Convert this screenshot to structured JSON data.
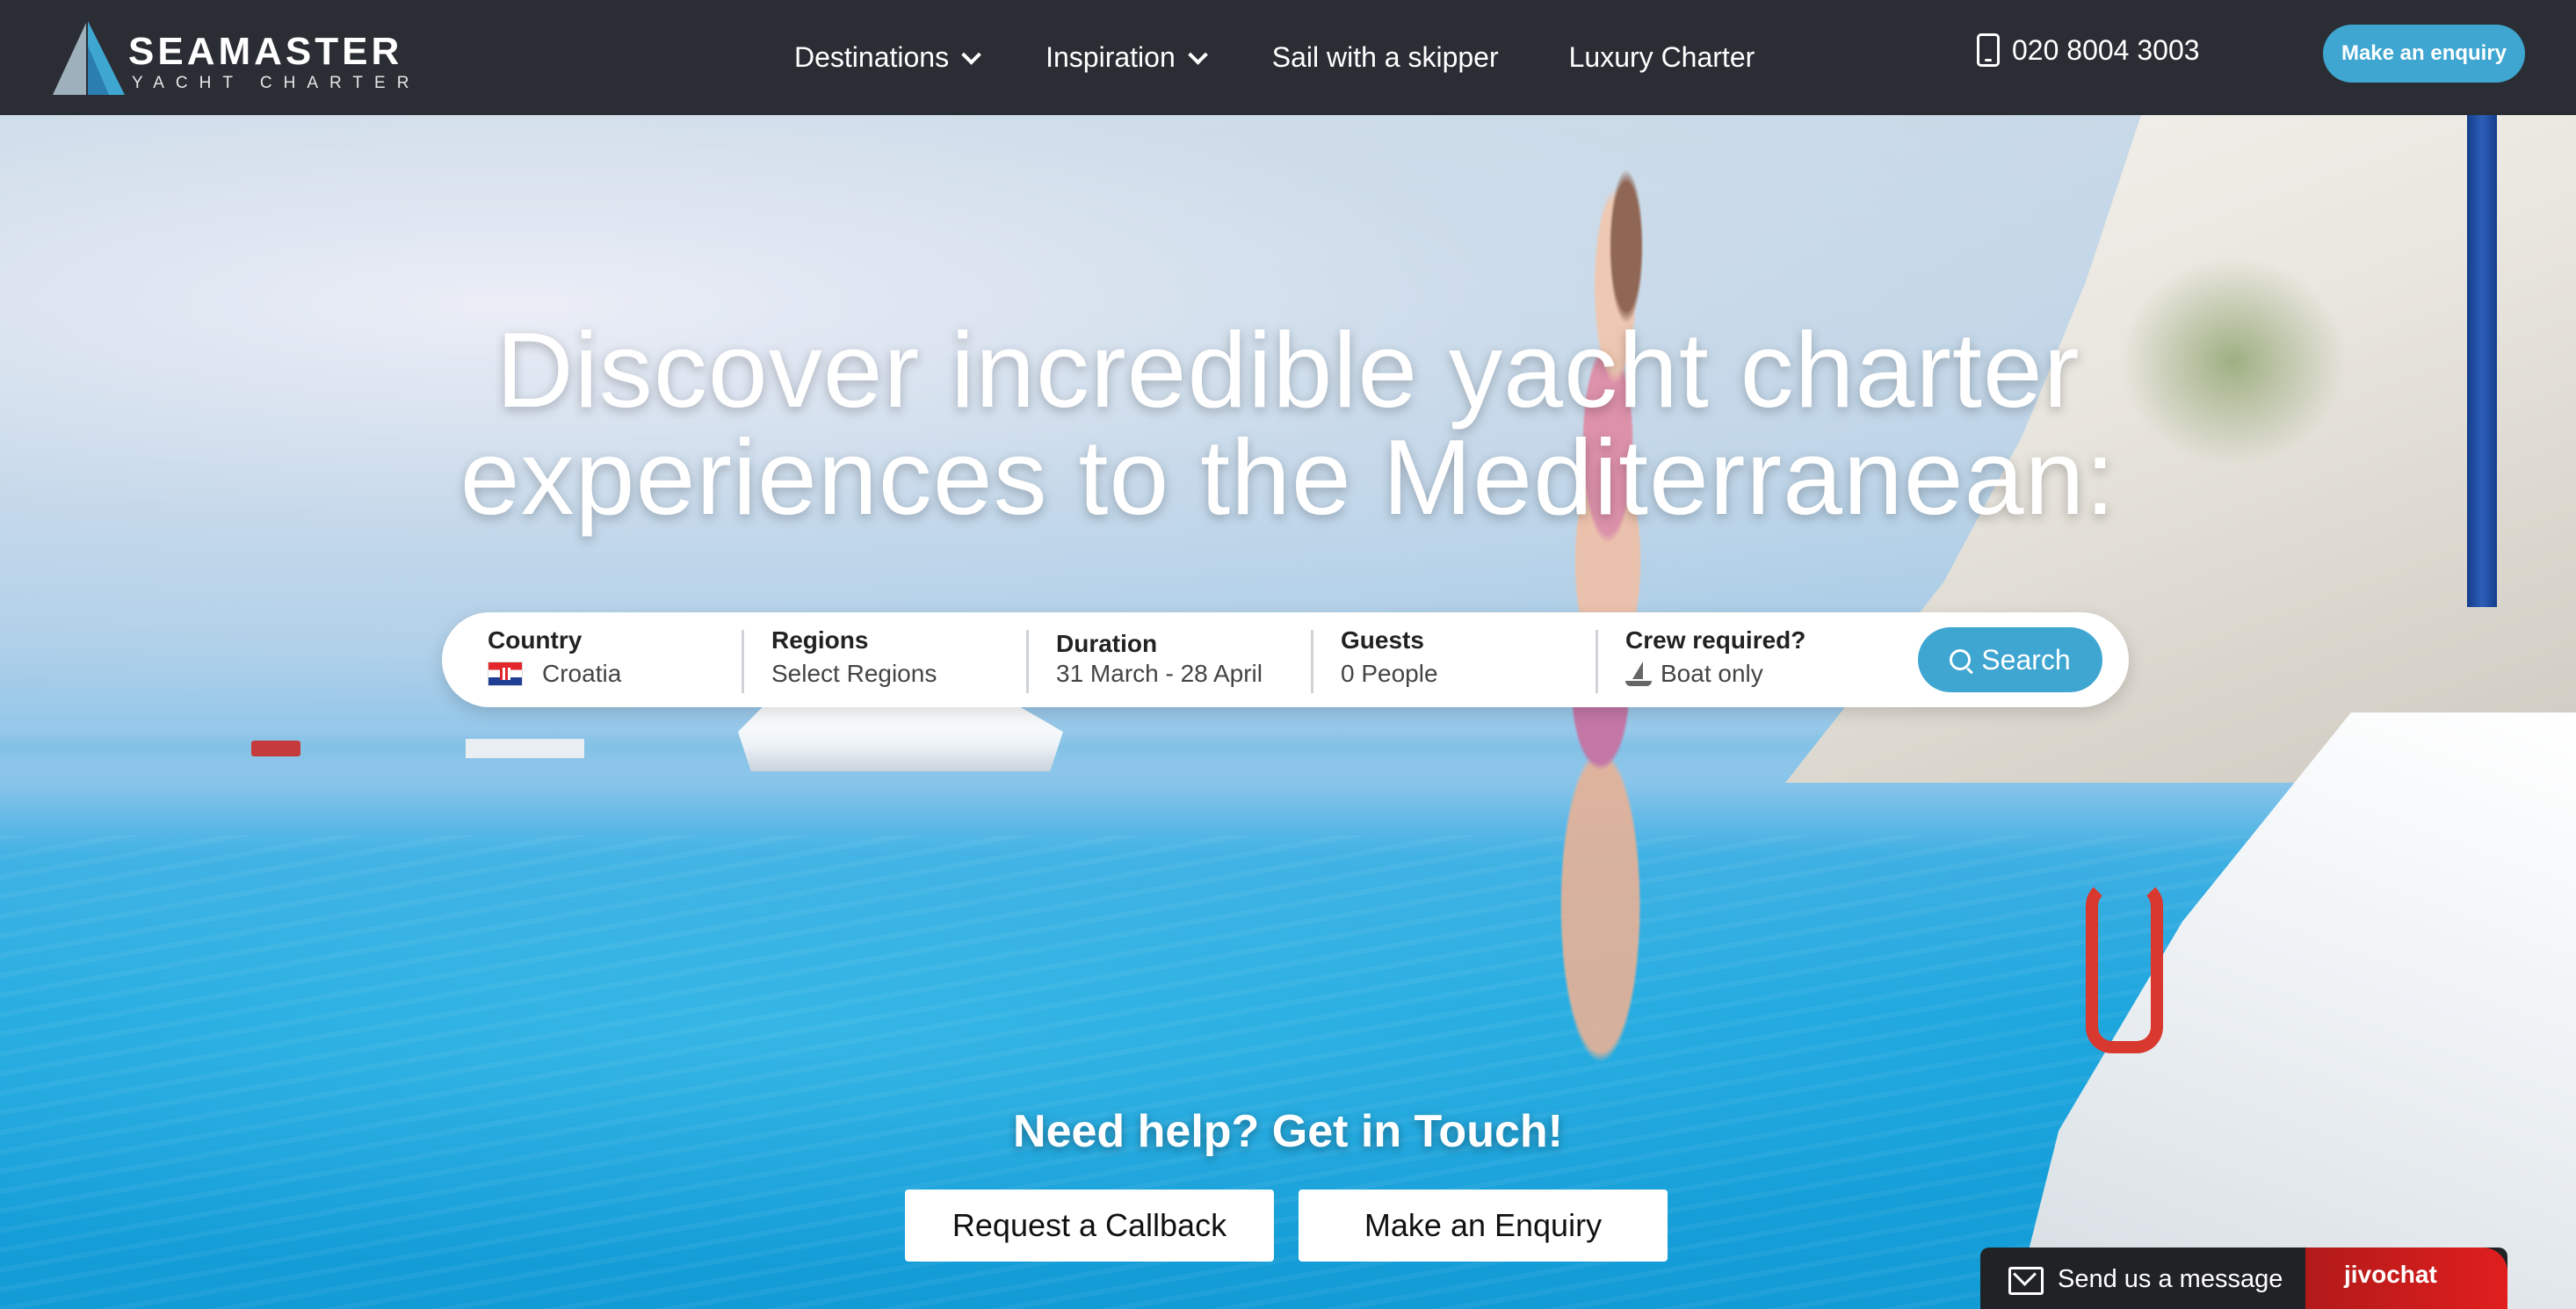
{
  "brand": {
    "name": "SEAMASTER",
    "tagline": "YACHT CHARTER",
    "accent_color": "#3ea6d1",
    "nav_background": "#2a2d33"
  },
  "nav": {
    "items": [
      {
        "label": "Destinations",
        "has_dropdown": true,
        "icon": "chevron-down-icon"
      },
      {
        "label": "Inspiration",
        "has_dropdown": true,
        "icon": "chevron-down-icon"
      },
      {
        "label": "Sail with a skipper",
        "has_dropdown": false
      },
      {
        "label": "Luxury Charter",
        "has_dropdown": false
      }
    ],
    "phone": "020 8004 3003",
    "phone_icon": "phone-icon",
    "enquiry_label": "Make an enquiry"
  },
  "hero": {
    "headline_line1": "Discover incredible yacht charter",
    "headline_line2": "experiences to the Mediterranean:"
  },
  "search": {
    "country": {
      "label": "Country",
      "value": "Croatia",
      "icon": "croatia-flag-icon"
    },
    "regions": {
      "label": "Regions",
      "value": "Select Regions"
    },
    "duration": {
      "label": "Duration",
      "value": "31 March - 28 April"
    },
    "guests": {
      "label": "Guests",
      "value": "0 People"
    },
    "crew": {
      "label": "Crew required?",
      "value": "Boat only",
      "icon": "sailboat-icon"
    },
    "button_label": "Search",
    "button_icon": "search-icon"
  },
  "help": {
    "title": "Need help? Get in Touch!",
    "callback_label": "Request a Callback",
    "enquiry_label": "Make an Enquiry"
  },
  "chat": {
    "message_label": "Send us a message",
    "brand": "jivochat",
    "icon": "mail-icon"
  }
}
